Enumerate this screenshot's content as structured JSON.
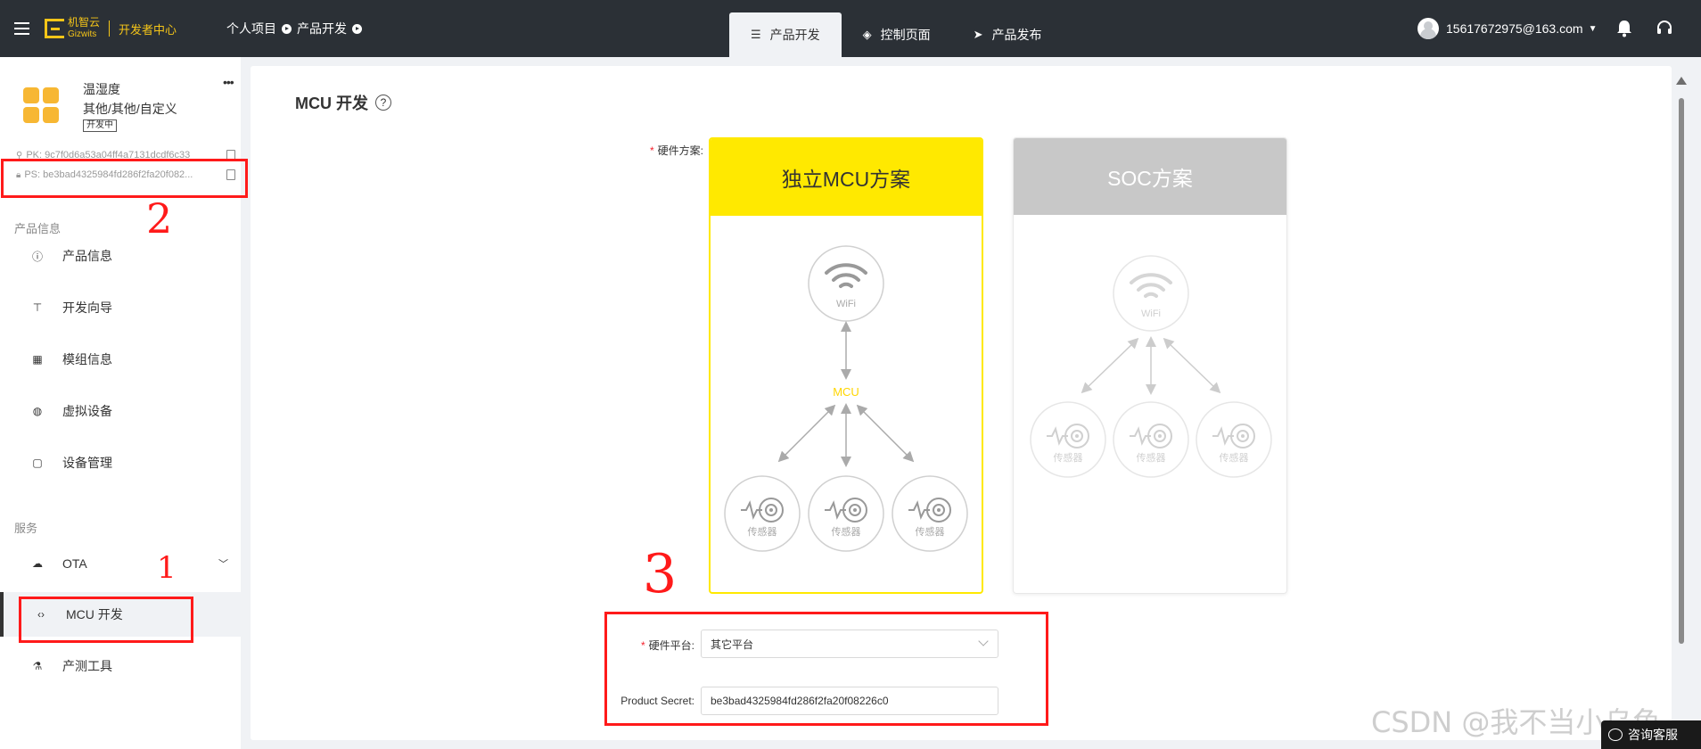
{
  "topbar": {
    "logo_cn": "机智云",
    "logo_en": "Gizwits",
    "logo_sub": "开发者中心",
    "breadcrumb": [
      "个人项目",
      "产品开发"
    ],
    "tabs": [
      {
        "label": "产品开发",
        "icon": "sliders-icon",
        "active": true
      },
      {
        "label": "控制页面",
        "icon": "diamond-icon",
        "active": false
      },
      {
        "label": "产品发布",
        "icon": "send-icon",
        "active": false
      }
    ],
    "user_email": "15617672975@163.com"
  },
  "product": {
    "name": "温湿度",
    "category": "其他/其他/自定义",
    "status": "开发中",
    "pk_label": "PK:",
    "pk_value": "9c7f0d6a53a04ff4a7131dcdf6c33",
    "ps_label": "PS:",
    "ps_value": "be3bad4325984fd286f2fa20f082..."
  },
  "sidebar": {
    "section_product": "产品信息",
    "section_service": "服务",
    "items_product": [
      {
        "label": "产品信息",
        "icon": "info-circle-icon"
      },
      {
        "label": "开发向导",
        "icon": "signpost-icon"
      },
      {
        "label": "模组信息",
        "icon": "grid-icon"
      },
      {
        "label": "虚拟设备",
        "icon": "globe-icon"
      },
      {
        "label": "设备管理",
        "icon": "clipboard-icon"
      }
    ],
    "items_service": [
      {
        "label": "OTA",
        "icon": "cloud-upload-icon",
        "expandable": true
      },
      {
        "label": "MCU 开发",
        "icon": "code-icon",
        "active": true
      },
      {
        "label": "产测工具",
        "icon": "test-tube-icon"
      }
    ]
  },
  "annotations": {
    "num1": "1",
    "num2": "2",
    "num3": "3"
  },
  "main": {
    "title": "MCU 开发",
    "help": "?",
    "hw_scheme_label": "硬件方案:",
    "cards": [
      {
        "title": "独立MCU方案",
        "selected": true,
        "wifi": "WiFi",
        "mcu": "MCU",
        "sensor": "传感器"
      },
      {
        "title": "SOC方案",
        "selected": false,
        "wifi": "WiFi",
        "sensor": "传感器"
      }
    ],
    "hw_platform_label": "硬件平台:",
    "hw_platform_value": "其它平台",
    "product_secret_label": "Product Secret:",
    "product_secret_value": "be3bad4325984fd286f2fa20f08226c0"
  },
  "watermark": "CSDN @我不当小乌龟",
  "chat_button": "咨询客服",
  "colors": {
    "topbar": "#2b3036",
    "brand_yellow": "#ffe900",
    "annotation_red": "#ff1a1a"
  }
}
